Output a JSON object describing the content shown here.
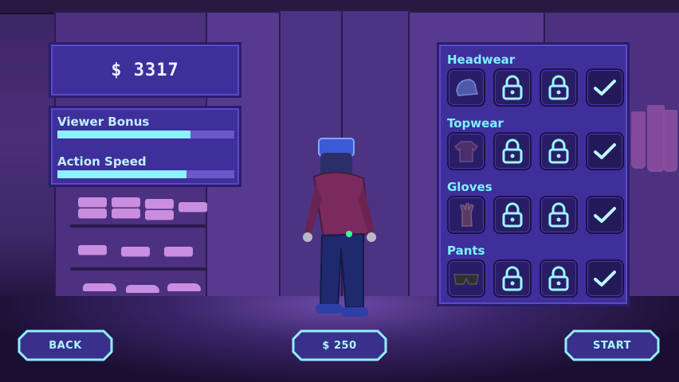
{
  "hud": {
    "money": "$ 3317"
  },
  "stats": [
    {
      "label": "Viewer Bonus",
      "level": 0.75
    },
    {
      "label": "Action Speed",
      "level": 0.73
    }
  ],
  "wardrobe": {
    "categories": [
      {
        "title": "Headwear",
        "slots": [
          {
            "state": "owned",
            "icon": "cap-icon"
          },
          {
            "state": "locked",
            "icon": "lock-icon"
          },
          {
            "state": "locked",
            "icon": "lock-icon"
          },
          {
            "state": "selected",
            "icon": "check-icon"
          }
        ]
      },
      {
        "title": "Topwear",
        "slots": [
          {
            "state": "owned",
            "icon": "shirt-icon"
          },
          {
            "state": "locked",
            "icon": "lock-icon"
          },
          {
            "state": "locked",
            "icon": "lock-icon"
          },
          {
            "state": "selected",
            "icon": "check-icon"
          }
        ]
      },
      {
        "title": "Gloves",
        "slots": [
          {
            "state": "owned",
            "icon": "glove-icon"
          },
          {
            "state": "locked",
            "icon": "lock-icon"
          },
          {
            "state": "locked",
            "icon": "lock-icon"
          },
          {
            "state": "selected",
            "icon": "check-icon"
          }
        ]
      },
      {
        "title": "Pants",
        "slots": [
          {
            "state": "owned",
            "icon": "pants-icon"
          },
          {
            "state": "locked",
            "icon": "lock-icon"
          },
          {
            "state": "locked",
            "icon": "lock-icon"
          },
          {
            "state": "selected",
            "icon": "check-icon"
          }
        ]
      }
    ]
  },
  "buttons": {
    "back": "BACK",
    "price": "$ 250",
    "start": "START"
  },
  "colors": {
    "accent": "#7ef2ff",
    "panel": "#3f2f9a",
    "bar_fill": "#8ff0ff"
  }
}
